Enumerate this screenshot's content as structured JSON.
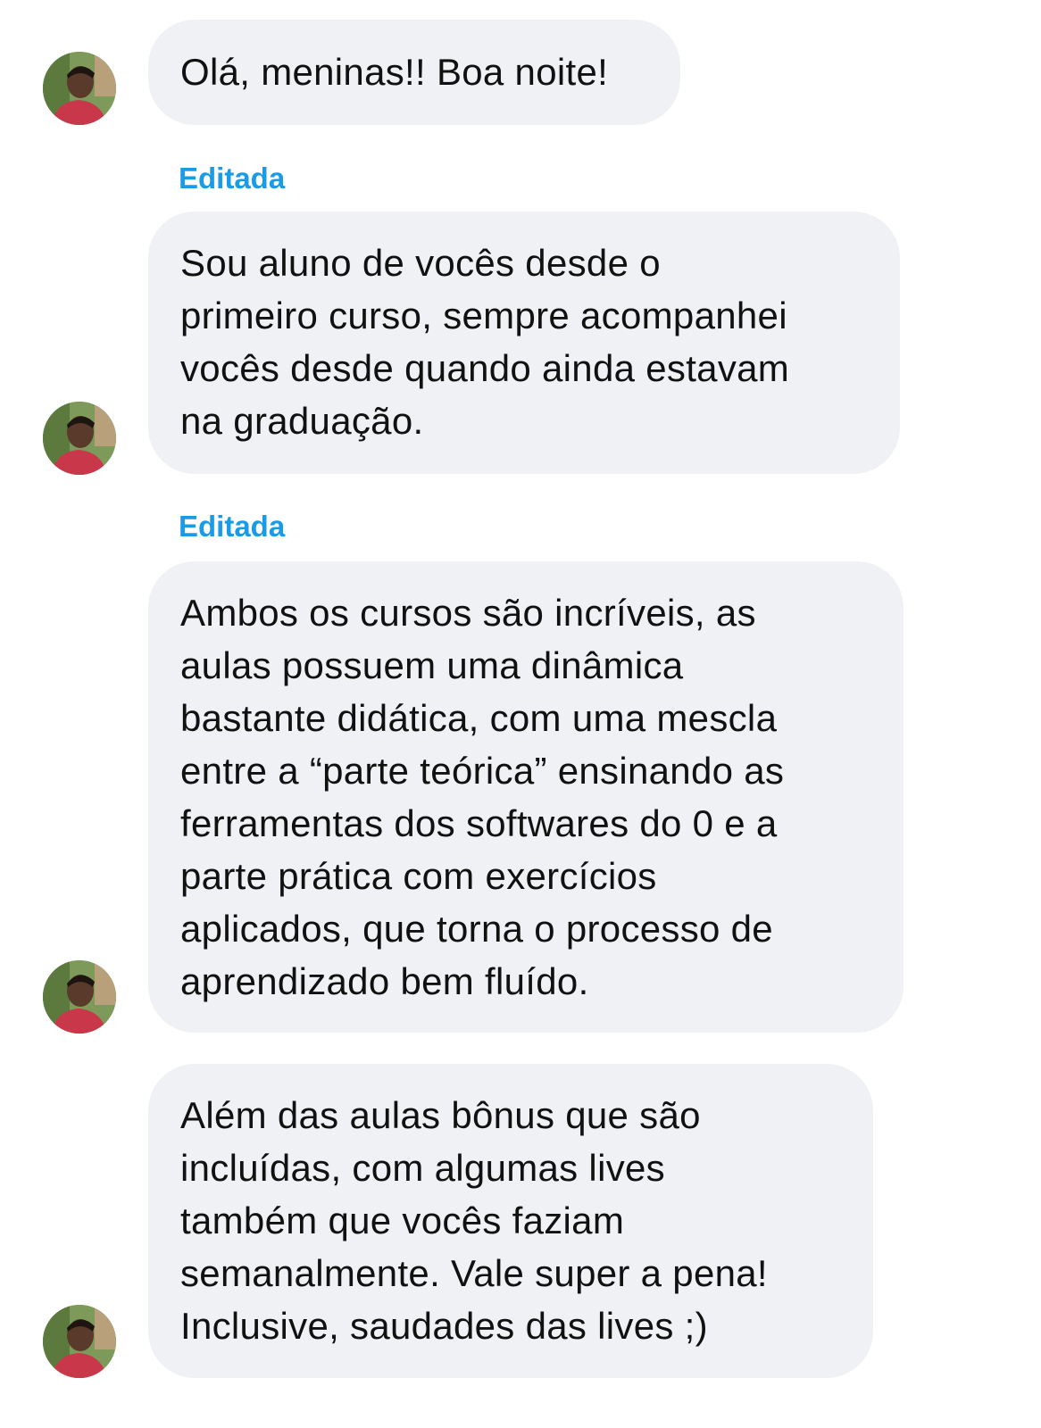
{
  "chat": {
    "messages": [
      {
        "lines": [
          "Olá, meninas!! Boa noite!"
        ],
        "edited": false
      },
      {
        "edited_label": "Editada",
        "lines": [
          "Sou aluno de vocês desde o",
          "primeiro curso, sempre acompanhei",
          "vocês desde quando ainda estavam",
          "na graduação."
        ]
      },
      {
        "edited_label": "Editada",
        "lines": [
          "Ambos os cursos são incríveis, as",
          "aulas possuem uma dinâmica",
          "bastante didática, com uma mescla",
          "entre a “parte teórica” ensinando as",
          "ferramentas dos softwares do 0 e a",
          "parte prática com exercícios",
          "aplicados, que torna o processo de",
          "aprendizado bem fluído."
        ]
      },
      {
        "lines": [
          "Além das aulas bônus que são",
          "incluídas, com algumas lives",
          "também que vocês faziam",
          "semanalmente. Vale super a pena!",
          "Inclusive, saudades das lives ;)"
        ]
      }
    ]
  },
  "colors": {
    "bubble_bg": "#f0f1f4",
    "edited_label": "#1a9be6",
    "text": "#111111"
  }
}
